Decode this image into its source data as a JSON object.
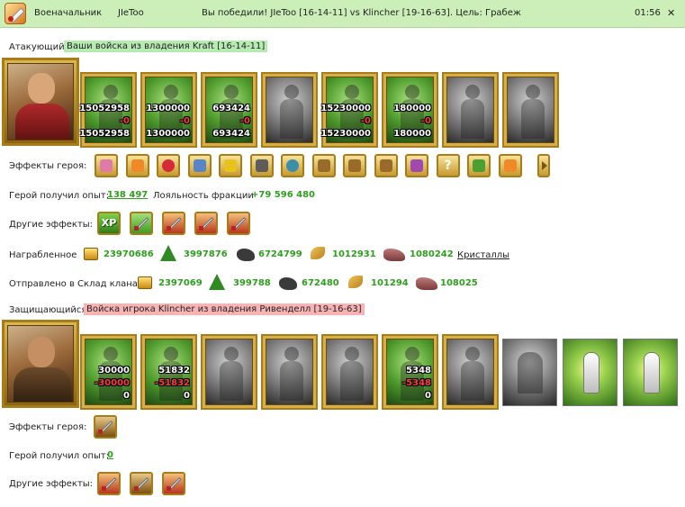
{
  "header": {
    "role": "Военачальник",
    "player": "JIeToo",
    "message": "Вы победили! JIeToo [16-14-11] vs Klincher [19-16-63]. Цель: Грабеж",
    "time": "01:56",
    "close_symbol": "✕"
  },
  "attacker": {
    "label": "Атакующий",
    "title": "Ваши войска из владения Kraft [16-14-11]",
    "units": [
      {
        "top": "15052958",
        "mid": "-0",
        "bottom": "15052958",
        "tone": "green"
      },
      {
        "top": "1300000",
        "mid": "-0",
        "bottom": "1300000",
        "tone": "green"
      },
      {
        "top": "693424",
        "mid": "-0",
        "bottom": "693424",
        "tone": "green"
      },
      {
        "top": "",
        "mid": "",
        "bottom": "",
        "tone": "gray"
      },
      {
        "top": "15230000",
        "mid": "-0",
        "bottom": "15230000",
        "tone": "green"
      },
      {
        "top": "180000",
        "mid": "-0",
        "bottom": "180000",
        "tone": "green"
      },
      {
        "top": "",
        "mid": "",
        "bottom": "",
        "tone": "gray"
      },
      {
        "top": "",
        "mid": "",
        "bottom": "",
        "tone": "gray"
      }
    ],
    "hero_effects_label": "Эффекты героя:",
    "hero_effects_icons": [
      "chest-icon",
      "fire-icon",
      "heart-icon",
      "shield-icon",
      "plant-icon",
      "armor-icon",
      "potion-icon",
      "claws-icon",
      "star-cross-icon",
      "banner-icon",
      "flower-icon",
      "question-icon",
      "herb-icon",
      "scroll-icon"
    ],
    "xp_label": "Герой получил опыт:",
    "xp_value": "138 497",
    "loyalty_label": "Лояльность фракции",
    "loyalty_value": "+79 596 480",
    "other_effects_label": "Другие эффекты:",
    "other_effects_icons": [
      "xp-icon",
      "sword-icon",
      "red-sword-icon",
      "red-sword-icon",
      "red-sword-icon"
    ],
    "xp_badge": "XP",
    "loot_label": "Награбленное",
    "loot": [
      "23970686",
      "3997876",
      "6724799",
      "1012931",
      "1080242"
    ],
    "crystals_link": "Кристаллы",
    "clan_label": "Отправлено в Склад клана",
    "clan": [
      "2397069",
      "399788",
      "672480",
      "101294",
      "108025"
    ]
  },
  "defender": {
    "label": "Защищающийся",
    "title": "Войска игрока Klincher из владения Ривенделл [19-16-63]",
    "units": [
      {
        "top": "30000",
        "mid": "-30000",
        "bottom": "0",
        "tone": "green"
      },
      {
        "top": "51832",
        "mid": "-51832",
        "bottom": "0",
        "tone": "green"
      },
      {
        "top": "",
        "mid": "",
        "bottom": "",
        "tone": "gray"
      },
      {
        "top": "",
        "mid": "",
        "bottom": "",
        "tone": "gray"
      },
      {
        "top": "",
        "mid": "",
        "bottom": "",
        "tone": "gray"
      },
      {
        "top": "5348",
        "mid": "-5348",
        "bottom": "0",
        "tone": "green"
      },
      {
        "top": "",
        "mid": "",
        "bottom": "",
        "tone": "gray"
      }
    ],
    "hero_effects_label": "Эффекты героя:",
    "xp_label": "Герой получил опыт:",
    "xp_value": "0",
    "other_effects_label": "Другие эффекты:"
  },
  "colors": {
    "header_bg": "#ccefb9",
    "highlight_green": "#b6ecb2",
    "highlight_red": "#f8b4b4",
    "value_green": "#2f9e1f",
    "loss_red": "#ff3c3c",
    "frame_gold": "#a87c18"
  }
}
